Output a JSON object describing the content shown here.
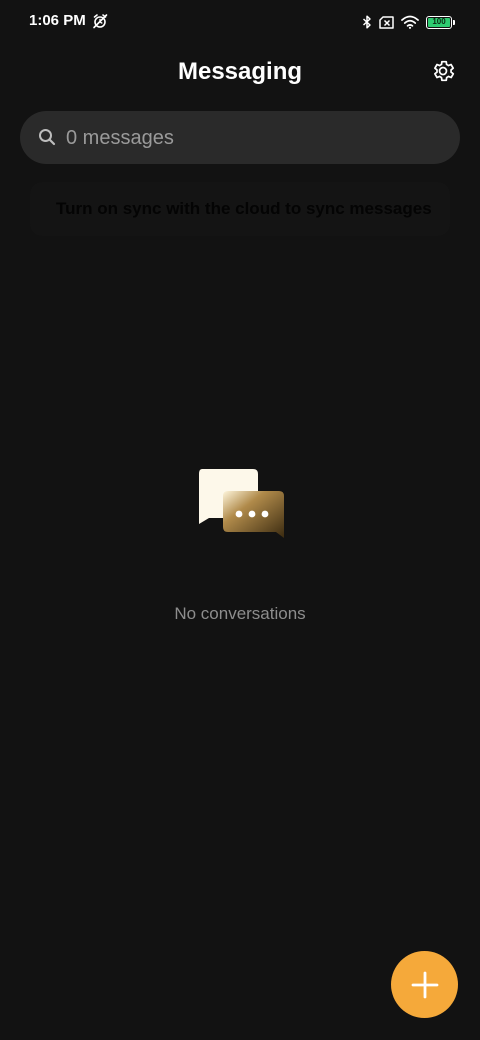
{
  "status_bar": {
    "time": "1:06 PM",
    "battery_level": "100",
    "battery_color": "#2ecc71",
    "icons": [
      "alarm-off-icon",
      "bluetooth-icon",
      "no-sim-icon",
      "wifi-icon",
      "battery-icon"
    ]
  },
  "header": {
    "title": "Messaging",
    "settings_icon": "gear-icon"
  },
  "search": {
    "placeholder": "0 messages",
    "icon": "search-icon"
  },
  "sync_banner": {
    "text": "Turn on sync with the cloud to sync messages"
  },
  "empty_state": {
    "icon": "chat-bubbles-icon",
    "text": "No conversations"
  },
  "fab": {
    "icon": "plus-icon",
    "color": "#f5a93a"
  }
}
